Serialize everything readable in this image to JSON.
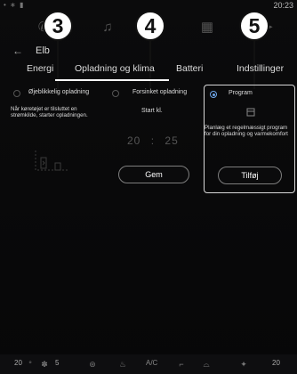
{
  "status_bar": {
    "time": "20:23"
  },
  "callouts": [
    "3",
    "4",
    "5"
  ],
  "header": {
    "back_symbol": "←",
    "title": "Elb"
  },
  "tabs": [
    {
      "label": "Energi"
    },
    {
      "label": "Opladning og klima",
      "active": true
    },
    {
      "label": "Batteri"
    },
    {
      "label": "Indstillinger"
    }
  ],
  "options": {
    "immediate": {
      "label": "Øjeblikkelig opladning",
      "description": "Når køretøjet er tilsluttet en strømkilde, starter opladningen."
    },
    "delayed": {
      "label": "Forsinket opladning",
      "start_label": "Start kl.",
      "hour": "20",
      "minute": "25",
      "separator": ":",
      "button": "Gem"
    },
    "program": {
      "label": "Program",
      "description": "Planlæg et regelmæssigt program for din opladning og varmekomfort",
      "button": "Tilføj",
      "selected": true
    }
  },
  "bottom_bar": {
    "left_temp": "20",
    "fan_speed": "5",
    "ac_label": "A/C",
    "right_temp": "20"
  },
  "colors": {
    "accent": "#6ea6e8",
    "background": "#0b0b0c"
  }
}
